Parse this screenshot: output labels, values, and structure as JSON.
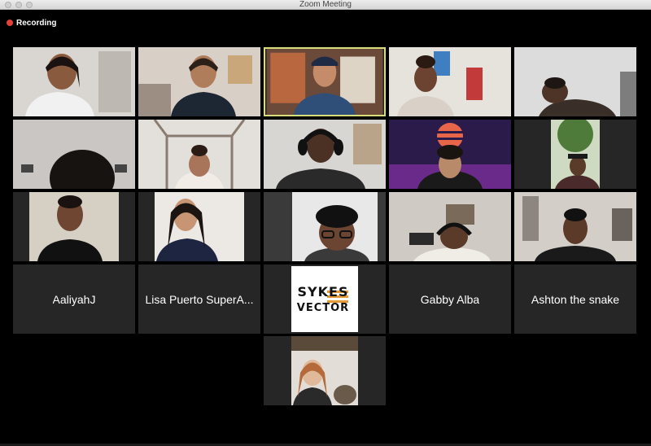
{
  "window": {
    "title": "Zoom Meeting"
  },
  "recording": {
    "label": "Recording",
    "color": "#e0413a"
  },
  "colors": {
    "active_speaker_border": "#d7dd7a",
    "tile_bg": "#262626",
    "background": "#000000"
  },
  "name_tiles": {
    "aaliyah": "AaliyahJ",
    "lisa": "Lisa Puerto SuperA...",
    "gabby": "Gabby Alba",
    "ashton": "Ashton the snake"
  },
  "logo": {
    "line1": "SYKES",
    "line2": "VECTOR"
  }
}
